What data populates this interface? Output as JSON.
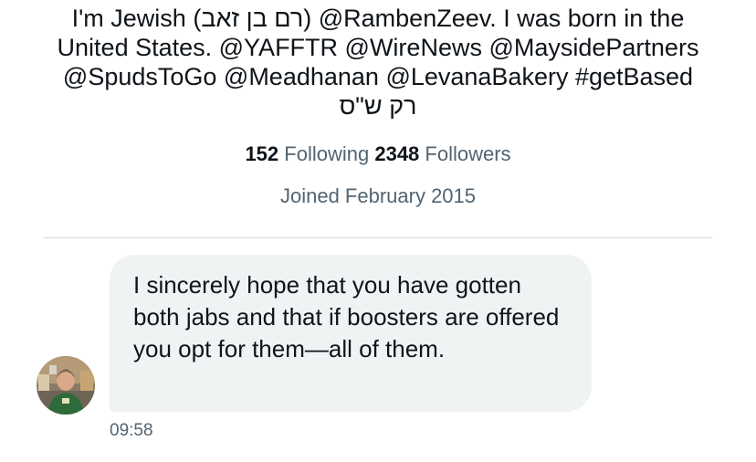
{
  "profile": {
    "bio_lines": [
      "I'm Jewish (רם בן זאב) @RambenZeev. I was born in the",
      "United States. @YAFFTR @WireNews @MaysidePartners",
      "@SpudsToGo @Meadhanan @LevanaBakery #getBased",
      "רק ש\"ס"
    ],
    "following_count": "152",
    "following_label": "Following",
    "followers_count": "2348",
    "followers_label": "Followers",
    "joined": "Joined February 2015"
  },
  "conversation": {
    "message": {
      "text": "I sincerely hope that you have gotten both jabs and that if boosters are offered you opt for them—all of them.",
      "time": "09:58"
    }
  },
  "colors": {
    "primary_text": "#0f1419",
    "secondary_text": "#536471",
    "bubble_background": "#eff3f4",
    "divider": "#cfd9de"
  }
}
